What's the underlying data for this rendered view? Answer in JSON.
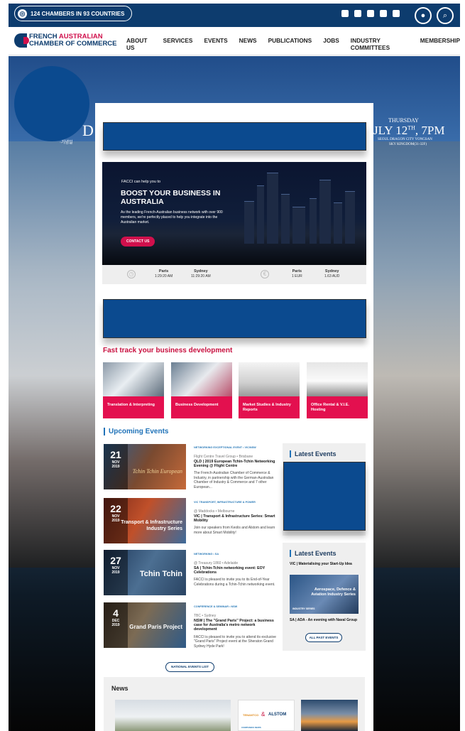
{
  "topbar": {
    "chambers_label": "124 CHAMBERS IN 93 COUNTRIES",
    "social_icons": [
      "instagram-icon",
      "linkedin-icon",
      "facebook-icon",
      "twitter-icon",
      "youtube-icon"
    ],
    "icons": {
      "account": "user-icon",
      "search": "search-icon"
    }
  },
  "brand": {
    "line1_blue": "FRENCH ",
    "line1_red": "AUSTRALIAN",
    "line2": "CHAMBER OF COMMERCE"
  },
  "nav": [
    "ABOUT US",
    "SERVICES",
    "EVENTS",
    "NEWS",
    "PUBLICATIONS",
    "JOBS",
    "INDUSTRY COMMITTEES",
    "MEMBERSHIP"
  ],
  "hero": {
    "left_text": "D",
    "left_sub": "·기념일",
    "right_top": "THURSDAY",
    "right_big": "JLY 12",
    "right_sup": "TH",
    "right_time": ", 7PM",
    "right_venue1": "SEOUL DRAGON CITY YONGSAN",
    "right_venue2": "SKY KINGDOM(31-32F)"
  },
  "boost": {
    "small": "FACCI can help you to",
    "big": "BOOST YOUR BUSINESS IN AUSTRALIA",
    "desc": "As the leading French-Australian business network with over 900 members, we're perfectly placed to help you integrate into the Australian market.",
    "cta": "CONTACT US"
  },
  "clocks": [
    {
      "city": "Paris",
      "time": "1:29:20 AM"
    },
    {
      "city": "Sydney",
      "time": "11:29:20 AM"
    }
  ],
  "currency": [
    {
      "city": "Paris",
      "value": "1 EUR"
    },
    {
      "city": "Sydney",
      "value": "1.63 AUD"
    }
  ],
  "fast_track": {
    "title": "Fast track your business development",
    "tiles": [
      "Translation & Interpreting",
      "Business Development",
      "Market Studies & Industry Reports",
      "Office Rental & V.I.E. Hosting"
    ]
  },
  "upcoming": {
    "title": "Upcoming Events",
    "events": [
      {
        "day": "21",
        "month": "NOV",
        "year": "2019",
        "img_title": "Tchin Tchin European",
        "category": "NETWORKING EXCEPTIONAL EVENT • VIC/NSW",
        "location": "Flight Centre Travel Group • Brisbane",
        "title": "QLD | 2019 European Tchin-Tchin Networking Evening @ Flight Centre",
        "desc": "The French-Australian Chamber of Commerce & Industry, in partnership with the German-Australian Chamber of Industry & Commerce and 7 other European..."
      },
      {
        "day": "22",
        "month": "NOV",
        "year": "2019",
        "img_title": "Transport & Infrastructure Industry Series",
        "category": "VIC TRANSPORT, INFRASTRUCTURE & POWER",
        "location": "@ Maddocks • Melbourne",
        "title": "VIC | Transport & Infrastructure Series: Smart Mobility",
        "desc": "Join our speakers from Keolis and Alstom and learn more about Smart Mobility!"
      },
      {
        "day": "27",
        "month": "NOV",
        "year": "2019",
        "img_title": "Tchin Tchin",
        "category": "NETWORKING • SA",
        "location": "@ Treasury 1860 • Adelaide",
        "title": "SA | Tchin-Tchin networking event: EOY Celebrations",
        "desc": "FACCI is pleased to invite you to its End-of-Year Celebrations during a Tchin-Tchin networking event."
      },
      {
        "day": "4",
        "month": "DEC",
        "year": "2019",
        "img_title": "Grand Paris Project",
        "category": "CONFERENCE & SEMINAR • NSW",
        "location": "TBC • Sydney",
        "title": "NSW | The ''Grand Paris'' Project: a business case for Australia's metro network development",
        "desc": "FACCI is pleased to invite you to attend its exclusive ''Grand Paris'' Project event at the Sheraton Grand Sydney Hyde Park!"
      }
    ],
    "list_button": "NATIONAL EVENTS LIST"
  },
  "sidebar": {
    "latest_title_1": "Latest Events",
    "latest_title_2": "Latest Events",
    "item1": "VIC | Materialising your Start-Up Idea",
    "img_label": "Aerospace, Defence & Aviation Industry Series",
    "img_tag": "INDUSTRY SERIES",
    "item2": "SA | ADA - An evening with Naval Group",
    "all_button": "ALL PAST EVENTS"
  },
  "news": {
    "title": "News",
    "alstom": "ALSTOM",
    "tenant": "TENANTCO",
    "amp": "&",
    "tag": "COMPANIES NEWS"
  },
  "colors": {
    "navy": "#0d3c6e",
    "accent_red": "#d0104c",
    "tile_red": "#e3104f",
    "link_blue": "#1f72b8",
    "ad_blue": "#0b4a8f"
  }
}
